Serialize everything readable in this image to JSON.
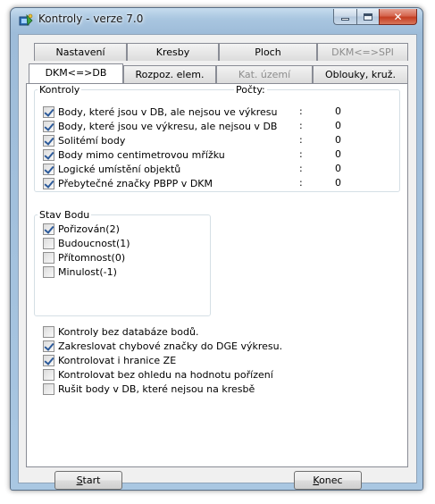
{
  "window": {
    "title": "Kontroly - verze 7.0",
    "icon": "app-icon",
    "controls": {
      "minimize": "minimize-icon",
      "maximize": "maximize-icon",
      "close": "close-icon"
    },
    "close_glyph": "✕"
  },
  "tabs_row1": [
    {
      "label": "Nastavení",
      "disabled": false
    },
    {
      "label": "Kresby",
      "disabled": false
    },
    {
      "label": "Ploch",
      "disabled": false
    },
    {
      "label": "DKM<=>SPI",
      "disabled": true
    }
  ],
  "tabs_row2": [
    {
      "label": "DKM<=>DB",
      "active": true,
      "disabled": false
    },
    {
      "label": "Rozpoz. elem.",
      "active": false,
      "disabled": false
    },
    {
      "label": "Kat. území",
      "active": false,
      "disabled": true
    },
    {
      "label": "Oblouky, kruž.",
      "active": false,
      "disabled": false
    }
  ],
  "kontroly": {
    "group_label": "Kontroly",
    "counts_label": "Počty:",
    "separator": ":",
    "items": [
      {
        "label": "Body, které jsou v DB, ale nejsou ve výkresu",
        "checked": true,
        "count": "0"
      },
      {
        "label": "Body, které jsou ve výkresu, ale nejsou v DB",
        "checked": true,
        "count": "0"
      },
      {
        "label": "Solitémí body",
        "checked": true,
        "count": "0"
      },
      {
        "label": "Body mimo centimetrovou mřížku",
        "checked": true,
        "count": "0"
      },
      {
        "label": "Logické umístění objektů",
        "checked": true,
        "count": "0"
      },
      {
        "label": "Přebytečné značky PBPP v DKM",
        "checked": true,
        "count": "0"
      }
    ]
  },
  "stav_bodu": {
    "group_label": "Stav Bodu",
    "items": [
      {
        "label": "Pořizován(2)",
        "checked": true
      },
      {
        "label": "Budoucnost(1)",
        "checked": false
      },
      {
        "label": "Přítomnost(0)",
        "checked": false
      },
      {
        "label": "Minulost(-1)",
        "checked": false
      }
    ]
  },
  "options": [
    {
      "label": "Kontroly bez databáze bodů.",
      "checked": false
    },
    {
      "label": "Zakreslovat chybové značky do DGE výkresu.",
      "checked": true
    },
    {
      "label": "Kontrolovat i hranice ZE",
      "checked": true
    },
    {
      "label": "Kontrolovat bez ohledu na hodnotu pořízení",
      "checked": false
    },
    {
      "label": "Rušit body v DB, které nejsou na kresbě",
      "checked": false
    }
  ],
  "buttons": {
    "start": {
      "mnemonic": "S",
      "rest": "tart"
    },
    "konec": {
      "mnemonic": "K",
      "rest": "onec"
    }
  },
  "colors": {
    "frame": "#a9c6e0",
    "client": "#f0f0f0",
    "check_mark": "#2c5a9a",
    "disabled_text": "#8d8d8d"
  }
}
